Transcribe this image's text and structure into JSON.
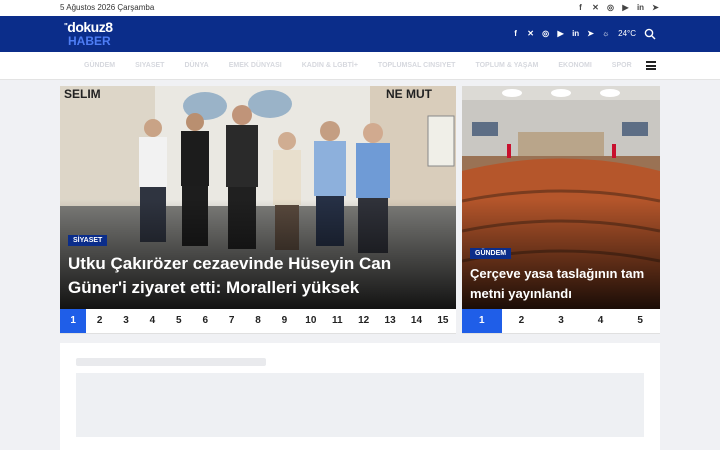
{
  "topbar": {
    "date": "5 Ağustos 2026 Çarşamba",
    "social_icons": [
      "facebook-icon",
      "x-icon",
      "instagram-icon",
      "youtube-icon",
      "linkedin-icon",
      "telegram-icon"
    ]
  },
  "header": {
    "logo_line1": "dokuz8",
    "logo_line2": "HABER",
    "weather": "24°C",
    "icons": [
      "facebook-icon",
      "x-icon",
      "instagram-icon",
      "youtube-icon",
      "linkedin-icon",
      "telegram-icon",
      "weather-icon",
      "search-icon"
    ]
  },
  "nav": {
    "items": [
      "Gündem",
      "Siyaset",
      "Dünya",
      "Emek Dünyası",
      "Kadın & LGBTİ+",
      "Toplumsal Cinsiyet",
      "Toplum & Yaşam",
      "Ekonomi",
      "Spor"
    ],
    "menu_icon": "hamburger-icon"
  },
  "main_slider": {
    "category": "SİYASET",
    "headline": "Utku Çakırözer cezaevinde Hüseyin Can Güner'i ziyaret etti: Moralleri yüksek",
    "wall_text_left": "SELIM",
    "wall_text_right": "NE MUT",
    "pages": [
      "1",
      "2",
      "3",
      "4",
      "5",
      "6",
      "7",
      "8",
      "9",
      "10",
      "11",
      "12",
      "13",
      "14",
      "15"
    ],
    "active_page": 1
  },
  "side_slider": {
    "category": "GÜNDEM",
    "headline": "Çerçeve yasa taslağının tam metni yayınlandı",
    "pages": [
      "1",
      "2",
      "3",
      "4",
      "5"
    ],
    "active_page": 1
  },
  "colors": {
    "header_bg": "#0b2d8a",
    "accent": "#1f5ee8",
    "logo_accent": "#4e7df4"
  }
}
